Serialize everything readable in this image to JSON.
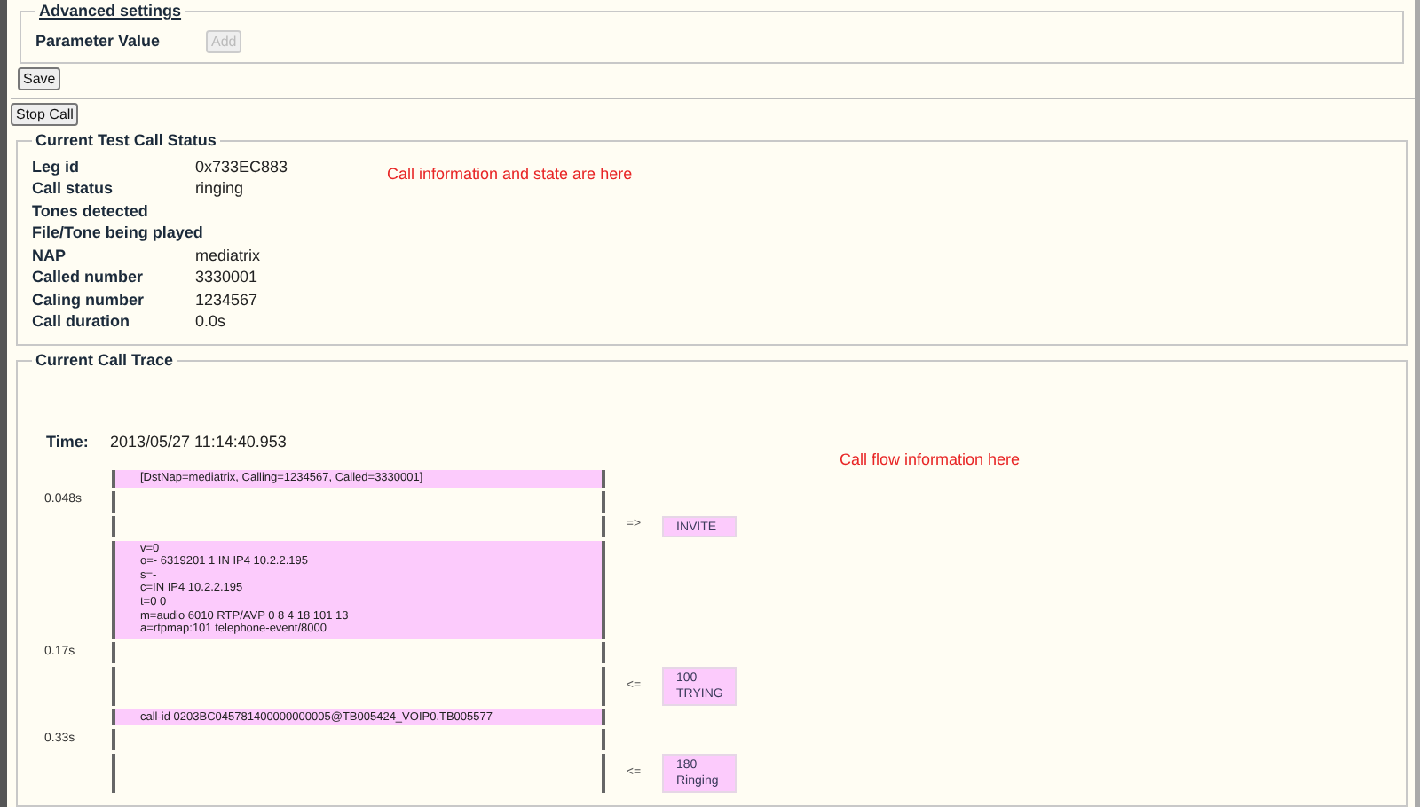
{
  "advanced_settings": {
    "legend": "Advanced settings",
    "parameter_label": "Parameter Value",
    "add_button": {
      "label": "Add",
      "disabled": true
    }
  },
  "save_button": {
    "label": "Save",
    "disabled": false
  },
  "stop_call_button": {
    "label": "Stop Call",
    "disabled": false
  },
  "call_status": {
    "legend": "Current Test Call Status",
    "note": "Call information and state are here",
    "fields": [
      {
        "label": "Leg id",
        "value": "0x733EC883"
      },
      {
        "label": "Call status",
        "value": "ringing"
      },
      {
        "label": "Tones detected"
      },
      {
        "label": "File/Tone being played"
      },
      {
        "label": "NAP",
        "value": "mediatrix"
      },
      {
        "label": "Called number",
        "value": "3330001"
      },
      {
        "label": "Caling number",
        "value": "1234567"
      },
      {
        "label": "Call duration",
        "value": "0.0s"
      }
    ]
  },
  "call_trace": {
    "legend": "Current Call Trace",
    "note": "Call flow information here",
    "time_label": "Time:",
    "time_value": "2013/05/27 11:14:40.953",
    "rows": [
      {
        "kind": "info",
        "text": "[DstNap=mediatrix, Calling=1234567, Called=3330001]"
      },
      {
        "kind": "time",
        "text": "0.048s"
      },
      {
        "kind": "message",
        "arrow": "=>",
        "text": "INVITE"
      },
      {
        "kind": "info",
        "text": "v=0\no=- 6319201 1 IN IP4 10.2.2.195\ns=-\nc=IN IP4 10.2.2.195\nt=0 0\nm=audio 6010 RTP/AVP 0 8 4 18 101 13\na=rtpmap:101 telephone-event/8000"
      },
      {
        "kind": "time",
        "text": "0.17s"
      },
      {
        "kind": "message",
        "arrow": "<=",
        "text": "100\nTRYING"
      },
      {
        "kind": "info",
        "text": "call-id 0203BC045781400000000005@TB005424_VOIP0.TB005577"
      },
      {
        "kind": "time",
        "text": "0.33s"
      },
      {
        "kind": "message",
        "arrow": "<=",
        "text": "180\nRinging"
      }
    ]
  }
}
